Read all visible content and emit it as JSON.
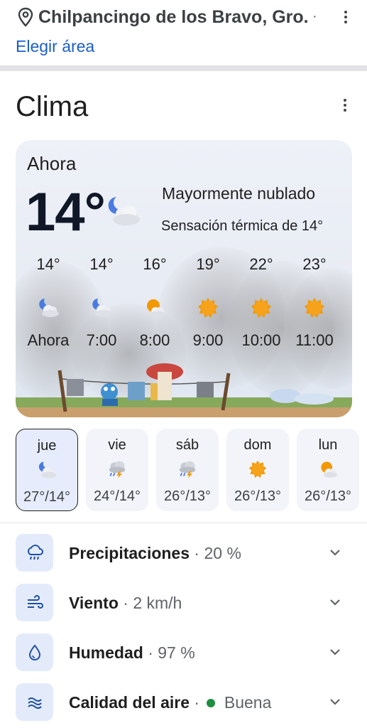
{
  "location": {
    "name": "Chilpancingo de los Bravo, Gro.",
    "separator": "·",
    "change_area": "Elegir área",
    "pin_icon": "location-pin-icon",
    "menu_icon": "more-vert-icon"
  },
  "weather": {
    "title": "Clima",
    "menu_icon": "more-vert-icon",
    "now": {
      "label": "Ahora",
      "temp": "14°",
      "icon": "moon-cloud-icon",
      "condition": "Mayormente nublado",
      "feels_like": "Sensación térmica de 14°"
    },
    "hourly": [
      {
        "temp": "14°",
        "time": "Ahora",
        "icon": "moon-cloud-icon"
      },
      {
        "temp": "14°",
        "time": "7:00",
        "icon": "moon-cloud-icon"
      },
      {
        "temp": "16°",
        "time": "8:00",
        "icon": "sun-cloud-icon"
      },
      {
        "temp": "19°",
        "time": "9:00",
        "icon": "sun-icon"
      },
      {
        "temp": "22°",
        "time": "10:00",
        "icon": "sun-icon"
      },
      {
        "temp": "23°",
        "time": "11:00",
        "icon": "sun-icon"
      }
    ],
    "daily": [
      {
        "day": "jue",
        "range": "27°/14°",
        "icon": "moon-cloud-icon",
        "selected": true
      },
      {
        "day": "vie",
        "range": "24°/14°",
        "icon": "thunderstorm-icon",
        "selected": false
      },
      {
        "day": "sáb",
        "range": "26°/13°",
        "icon": "thunderstorm-icon",
        "selected": false
      },
      {
        "day": "dom",
        "range": "26°/13°",
        "icon": "sun-icon",
        "selected": false
      },
      {
        "day": "lun",
        "range": "26°/13°",
        "icon": "sun-cloud-icon",
        "selected": false
      }
    ],
    "details": [
      {
        "label": "Precipitaciones",
        "value": "20 %",
        "icon": "rain-cloud-icon"
      },
      {
        "label": "Viento",
        "value": "2 km/h",
        "icon": "wind-icon"
      },
      {
        "label": "Humedad",
        "value": "97 %",
        "icon": "water-drop-icon"
      },
      {
        "label": "Calidad del aire",
        "value": "Buena",
        "icon": "air-quality-icon",
        "status_color": "#1e8e3e"
      }
    ],
    "colors": {
      "accent": "#1a5ecc",
      "sun": "#f29900",
      "icon_bg": "#e3ebfb"
    }
  }
}
